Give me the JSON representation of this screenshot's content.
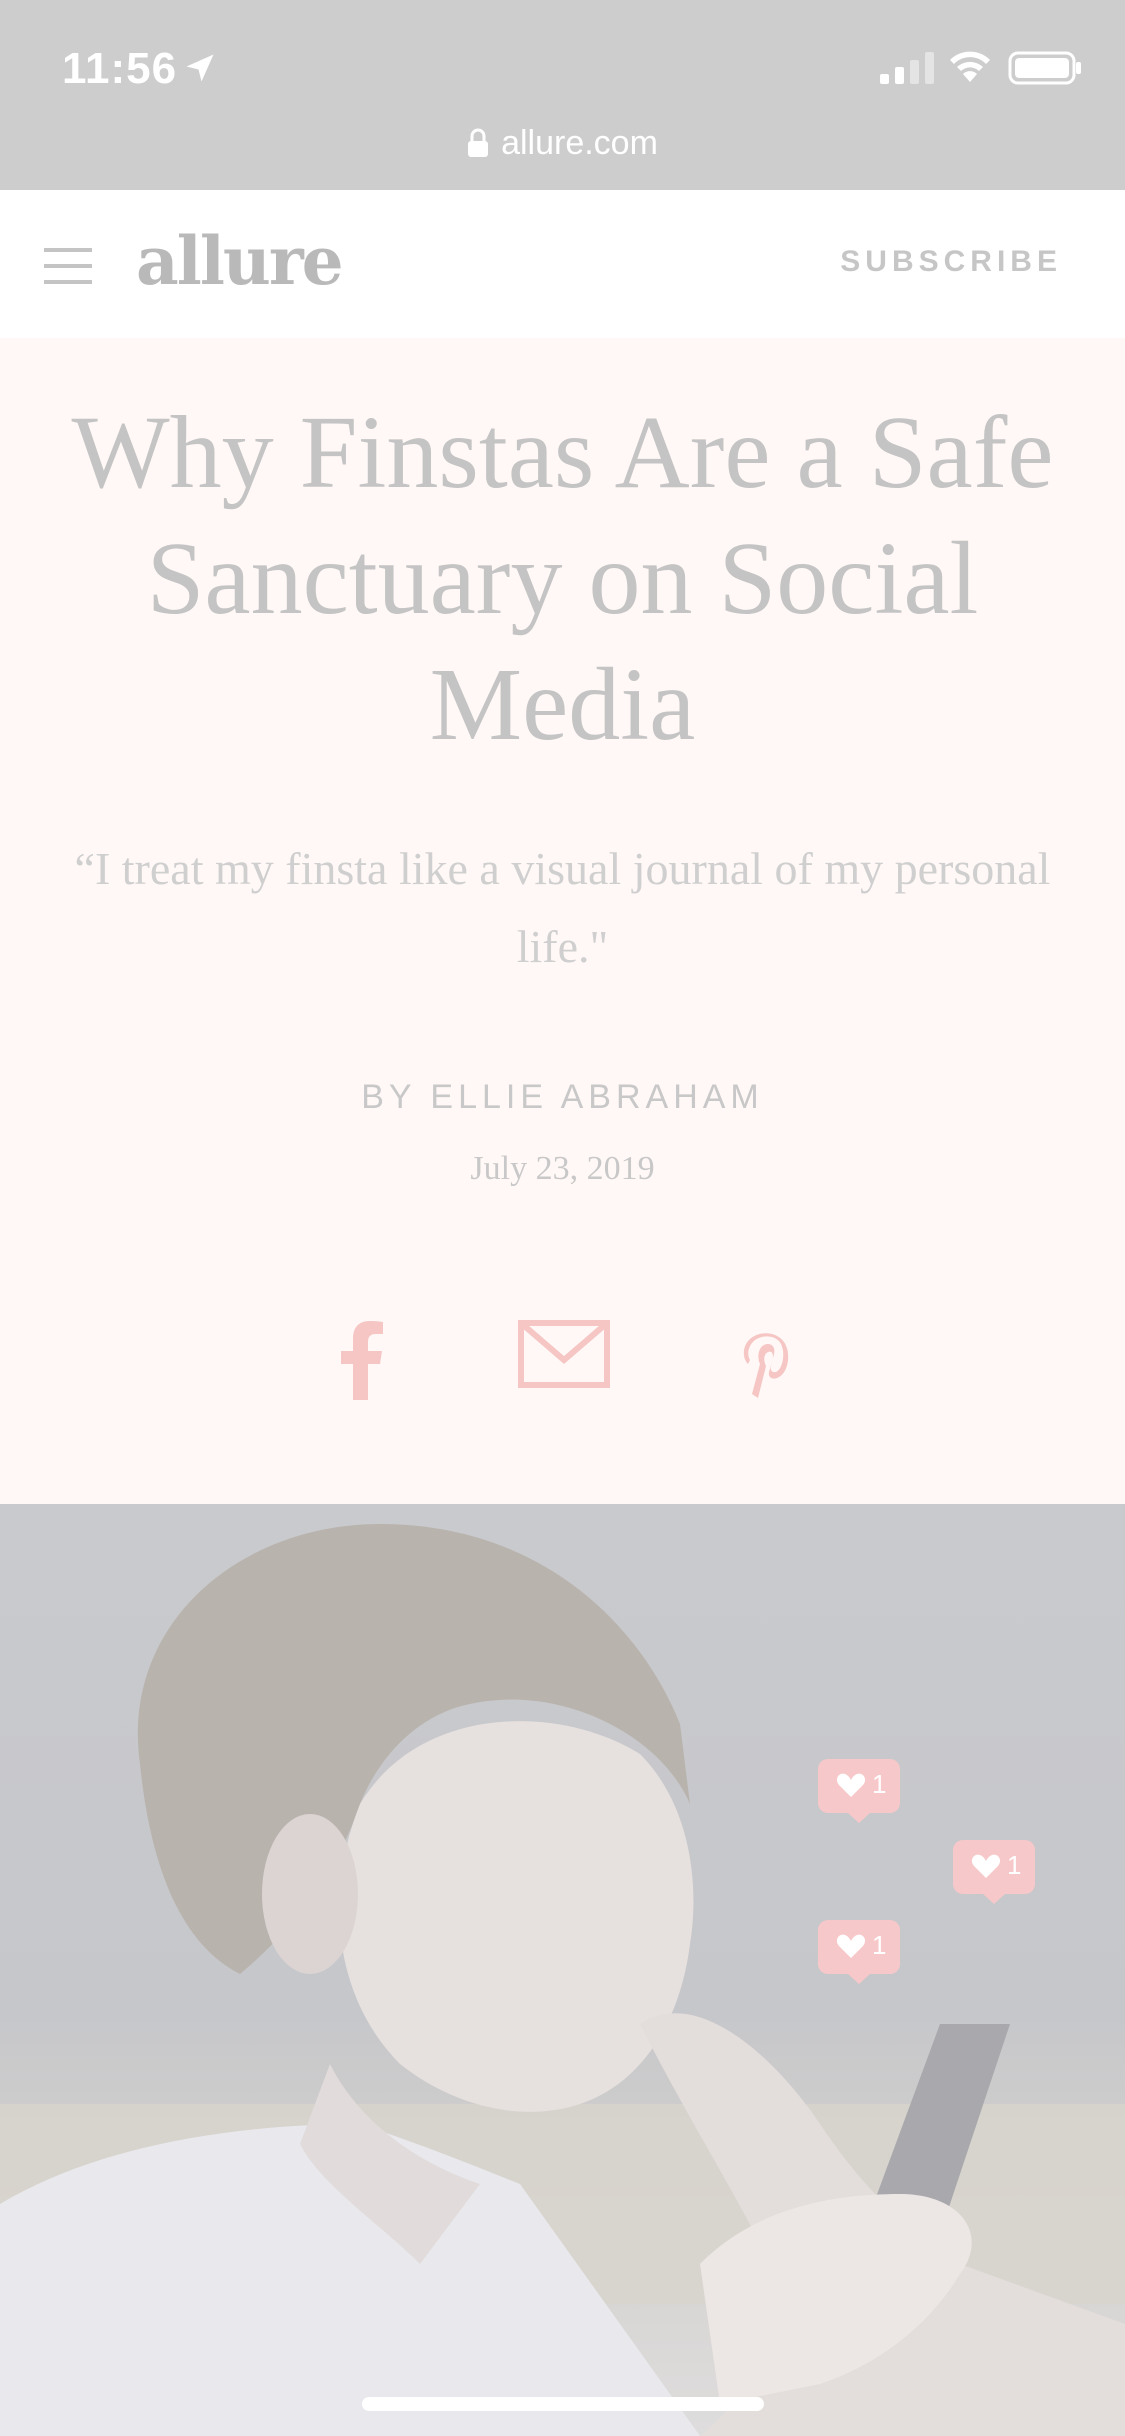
{
  "status_bar": {
    "time": "11:56",
    "icons": [
      "location-arrow-icon",
      "cellular-signal-icon",
      "wifi-icon",
      "battery-icon"
    ]
  },
  "browser": {
    "url": "allure.com",
    "lock_icon": "lock-icon"
  },
  "site_header": {
    "logo": "allure",
    "subscribe_label": "SUBSCRIBE",
    "menu_icon": "hamburger-menu-icon"
  },
  "article": {
    "headline": "Why Finstas Are a Safe Sanctuary on Social Media",
    "dek": "“I treat my finsta like a visual journal of my personal life.\"",
    "byline": "BY ELLIE ABRAHAM",
    "date": "July 23, 2019"
  },
  "share": {
    "buttons": [
      "facebook-icon",
      "email-icon",
      "pinterest-icon"
    ],
    "color": "#f5c6c4"
  },
  "hero_image": {
    "like_badges": [
      {
        "count": "1"
      },
      {
        "count": "1"
      },
      {
        "count": "1"
      }
    ],
    "badge_color": "#f6c8c9"
  }
}
